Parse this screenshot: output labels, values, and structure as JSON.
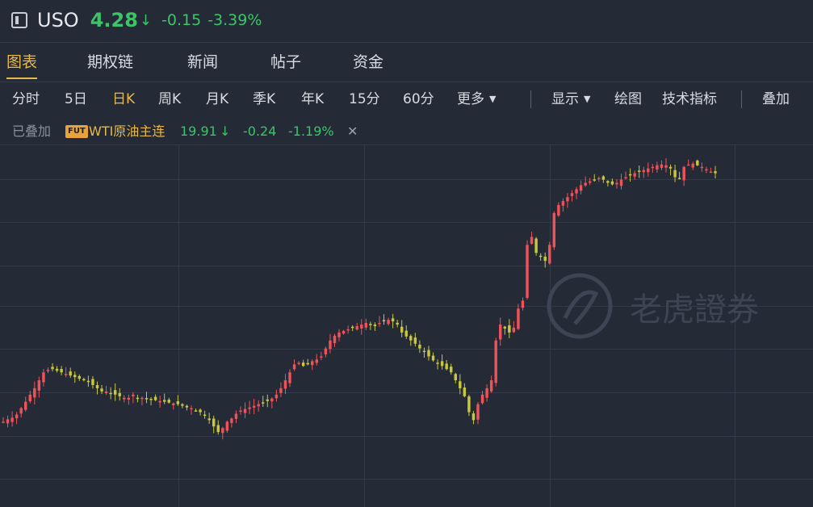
{
  "header": {
    "ticker": "USO",
    "price": "4.28",
    "arrow": "↓",
    "change": "-0.15",
    "change_pct": "-3.39%"
  },
  "tabs": [
    {
      "label": "图表",
      "active": true
    },
    {
      "label": "期权链"
    },
    {
      "label": "新闻"
    },
    {
      "label": "帖子"
    },
    {
      "label": "资金"
    }
  ],
  "periods": [
    {
      "label": "分时"
    },
    {
      "label": "5日"
    },
    {
      "label": "日K",
      "active": true
    },
    {
      "label": "周K"
    },
    {
      "label": "月K"
    },
    {
      "label": "季K"
    },
    {
      "label": "年K"
    },
    {
      "label": "15分"
    },
    {
      "label": "60分"
    },
    {
      "label": "更多"
    }
  ],
  "tools": {
    "display": "显示",
    "draw": "绘图",
    "indicators": "技术指标",
    "overlay": "叠加"
  },
  "overlay": {
    "label": "已叠加",
    "badge": "FUT",
    "name": "WTI原油主连",
    "price": "19.91",
    "arrow": "↓",
    "change": "-0.24",
    "change_pct": "-1.19%",
    "close": "✕"
  },
  "watermark": "老虎證券",
  "colors": {
    "up": "#f0525a",
    "down": "#c8c83c",
    "accent": "#e8b84a",
    "green": "#3dc469",
    "background": "#242a36"
  },
  "chart_data": {
    "type": "candlestick",
    "title": "",
    "xlabel": "",
    "ylabel": "",
    "grid": true,
    "close_series": [
      98,
      101,
      103,
      107,
      115,
      123,
      132,
      140,
      150,
      160,
      163,
      164,
      162,
      160,
      158,
      156,
      154,
      152,
      150,
      148,
      144,
      140,
      136,
      136,
      134,
      132,
      130,
      128,
      128,
      132,
      128,
      128,
      127,
      126,
      125,
      124,
      123,
      122,
      121,
      120,
      118,
      116,
      115,
      112,
      110,
      106,
      100,
      92,
      85,
      90,
      98,
      102,
      108,
      112,
      114,
      116,
      118,
      120,
      122,
      124,
      127,
      132,
      140,
      150,
      160,
      170,
      172,
      168,
      170,
      174,
      176,
      180,
      190,
      200,
      206,
      210,
      212,
      214,
      216,
      218,
      220,
      222,
      220,
      218,
      222,
      224,
      226,
      224,
      220,
      210,
      205,
      200,
      196,
      190,
      186,
      180,
      175,
      172,
      168,
      164,
      160,
      150,
      140,
      130,
      110,
      100,
      120,
      132,
      140,
      150,
      200,
      220,
      215,
      210,
      216,
      240,
      250,
      320,
      330,
      310,
      305,
      300,
      320,
      360,
      370,
      375,
      380,
      385,
      390,
      395,
      398,
      400,
      402,
      404,
      402,
      398,
      396,
      398,
      402,
      405,
      408,
      410,
      412,
      414,
      416,
      418,
      420,
      421,
      420,
      416,
      405,
      404,
      418,
      421,
      422,
      420,
      418,
      415,
      412,
      410
    ]
  }
}
